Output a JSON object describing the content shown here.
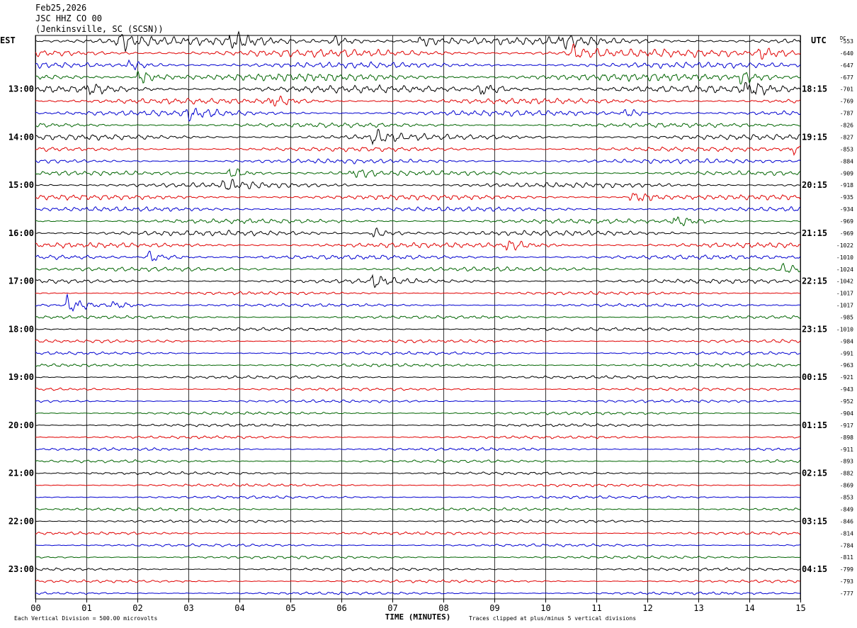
{
  "header": {
    "date": "Feb25,2026",
    "station": "JSC HHZ CO 00",
    "location": "(Jenkinsville, SC (SCSN))"
  },
  "chart_data": {
    "type": "line",
    "chart_kind": "helicorder",
    "left_timezone": "EST",
    "right_timezone": "UTC",
    "dc_label": "DC",
    "xlabel": "TIME (MINUTES)",
    "x_ticks": [
      "00",
      "01",
      "02",
      "03",
      "04",
      "05",
      "06",
      "07",
      "08",
      "09",
      "10",
      "11",
      "12",
      "13",
      "14",
      "15"
    ],
    "xlim": [
      0,
      15
    ],
    "lines_per_hour": 4,
    "line_colors": [
      "#000000",
      "#e00000",
      "#0000d0",
      "#006400"
    ],
    "left_time_labels": [
      {
        "line": 4,
        "text": "13:00"
      },
      {
        "line": 8,
        "text": "14:00"
      },
      {
        "line": 12,
        "text": "15:00"
      },
      {
        "line": 16,
        "text": "16:00"
      },
      {
        "line": 20,
        "text": "17:00"
      },
      {
        "line": 24,
        "text": "18:00"
      },
      {
        "line": 28,
        "text": "19:00"
      },
      {
        "line": 32,
        "text": "20:00"
      },
      {
        "line": 36,
        "text": "21:00"
      },
      {
        "line": 40,
        "text": "22:00"
      },
      {
        "line": 44,
        "text": "23:00"
      }
    ],
    "right_time_labels": [
      {
        "line": 4,
        "text": "18:15"
      },
      {
        "line": 8,
        "text": "19:15"
      },
      {
        "line": 12,
        "text": "20:15"
      },
      {
        "line": 16,
        "text": "21:15"
      },
      {
        "line": 20,
        "text": "22:15"
      },
      {
        "line": 24,
        "text": "23:15"
      },
      {
        "line": 28,
        "text": "00:15"
      },
      {
        "line": 32,
        "text": "01:15"
      },
      {
        "line": 36,
        "text": "02:15"
      },
      {
        "line": 40,
        "text": "03:15"
      },
      {
        "line": 44,
        "text": "04:15"
      }
    ],
    "dc_offsets": [
      "-553",
      "-640",
      "-647",
      "-677",
      "-701",
      "-769",
      "-787",
      "-826",
      "-827",
      "-853",
      "-884",
      "-909",
      "-918",
      "-935",
      "-934",
      "-969",
      "-969",
      "-1022",
      "-1010",
      "-1024",
      "-1042",
      "-1017",
      "-1017",
      "-985",
      "-1010",
      "-984",
      "-991",
      "-963",
      "-921",
      "-943",
      "-952",
      "-904",
      "-917",
      "-898",
      "-911",
      "-893",
      "-882",
      "-869",
      "-853",
      "-849",
      "-846",
      "-814",
      "-784",
      "-811",
      "-799",
      "-793",
      "-777"
    ],
    "line_amplitude": [
      4.5,
      4.5,
      3.5,
      4.5,
      4.2,
      3.2,
      3.2,
      2.6,
      3.2,
      2.6,
      2.6,
      2.6,
      3.0,
      3.0,
      2.6,
      2.6,
      3.0,
      3.0,
      2.6,
      2.4,
      2.4,
      1.8,
      1.8,
      1.8,
      1.8,
      1.8,
      1.7,
      1.7,
      1.7,
      1.6,
      1.6,
      1.6,
      1.6,
      1.6,
      1.6,
      1.6,
      1.6,
      1.6,
      1.6,
      1.6,
      1.6,
      1.6,
      1.6,
      1.6,
      1.6,
      1.6,
      1.6
    ],
    "events": [
      {
        "line": 0,
        "minute": 1.6,
        "amplitude": 14
      },
      {
        "line": 0,
        "minute": 3.8,
        "amplitude": 12
      },
      {
        "line": 0,
        "minute": 5.8,
        "amplitude": 8
      },
      {
        "line": 0,
        "minute": 7.5,
        "amplitude": 7
      },
      {
        "line": 0,
        "minute": 10.3,
        "amplitude": 9
      },
      {
        "line": 1,
        "minute": 10.5,
        "amplitude": 12
      },
      {
        "line": 1,
        "minute": 14.2,
        "amplitude": 9
      },
      {
        "line": 2,
        "minute": 1.8,
        "amplitude": 7
      },
      {
        "line": 3,
        "minute": 2.0,
        "amplitude": 10
      },
      {
        "line": 3,
        "minute": 13.8,
        "amplitude": 9
      },
      {
        "line": 4,
        "minute": 1.0,
        "amplitude": 8
      },
      {
        "line": 4,
        "minute": 8.7,
        "amplitude": 10
      },
      {
        "line": 4,
        "minute": 13.9,
        "amplitude": 10
      },
      {
        "line": 5,
        "minute": 4.6,
        "amplitude": 9
      },
      {
        "line": 6,
        "minute": 3.0,
        "amplitude": 9
      },
      {
        "line": 6,
        "minute": 11.5,
        "amplitude": 6
      },
      {
        "line": 8,
        "minute": 6.6,
        "amplitude": 10
      },
      {
        "line": 9,
        "minute": 14.8,
        "amplitude": 7
      },
      {
        "line": 11,
        "minute": 3.8,
        "amplitude": 8
      },
      {
        "line": 11,
        "minute": 6.2,
        "amplitude": 7
      },
      {
        "line": 12,
        "minute": 3.7,
        "amplitude": 8
      },
      {
        "line": 13,
        "minute": 11.7,
        "amplitude": 10
      },
      {
        "line": 15,
        "minute": 12.5,
        "amplitude": 9
      },
      {
        "line": 16,
        "minute": 6.6,
        "amplitude": 8
      },
      {
        "line": 17,
        "minute": 9.2,
        "amplitude": 8
      },
      {
        "line": 18,
        "minute": 2.2,
        "amplitude": 9
      },
      {
        "line": 19,
        "minute": 14.6,
        "amplitude": 6
      },
      {
        "line": 20,
        "minute": 6.6,
        "amplitude": 9
      },
      {
        "line": 22,
        "minute": 0.6,
        "amplitude": 14
      },
      {
        "line": 22,
        "minute": 1.5,
        "amplitude": 6
      }
    ],
    "footer_left": "Each Vertical Division =  500.00 microvolts",
    "footer_right": "Traces clipped at plus/minus 5 vertical divisions"
  }
}
